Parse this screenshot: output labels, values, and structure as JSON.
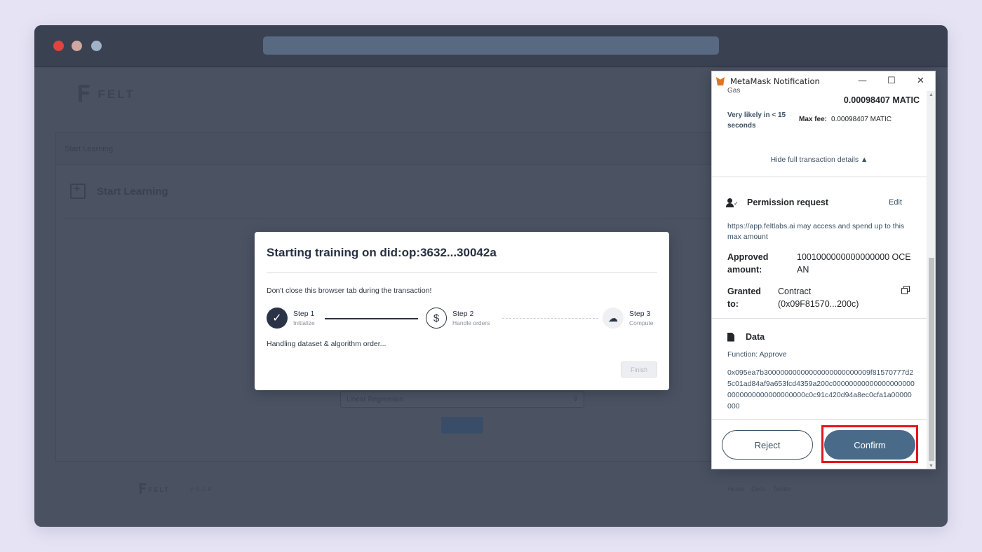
{
  "colors": {
    "accent": "#4a6a8a",
    "highlight": "#e8141b",
    "dark_text": "#24272a",
    "link": "#3b5165"
  },
  "background_app": {
    "logo_text": "FELT",
    "breadcrumb": "Start Learning",
    "page_title": "Start Learning",
    "model_select_value": "Linear Regression",
    "footer_logo_text": "FELT",
    "footer_version": "v 0.1.0",
    "footer_links": [
      "Home",
      "Docs",
      "Twitter"
    ]
  },
  "modal": {
    "title": "Starting training on did:op:3632...30042a",
    "warning": "Don't close this browser tab during the transaction!",
    "steps": [
      {
        "label": "Step 1",
        "sub": "Initialize",
        "icon": "check-icon",
        "state": "done"
      },
      {
        "label": "Step 2",
        "sub": "Handle orders",
        "icon": "dollar-icon",
        "state": "active"
      },
      {
        "label": "Step 3",
        "sub": "Compute",
        "icon": "cloud-icon",
        "state": "pending"
      }
    ],
    "status": "Handling dataset & algorithm order...",
    "finish_label": "Finish"
  },
  "metamask": {
    "window_title": "MetaMask Notification",
    "gas_label": "Gas",
    "gas_value": "0.00098407 MATIC",
    "likely_text": "Very likely in < 15 seconds",
    "max_fee_label": "Max fee:",
    "max_fee_value": "0.00098407 MATIC",
    "hide_details": "Hide full transaction details ▲",
    "permission_title": "Permission request",
    "edit_label": "Edit",
    "permission_desc": "https://app.feltlabs.ai may access and spend up to this max amount",
    "approved_label": "Approved amount:",
    "approved_value": "1001000000000000000 OCEAN",
    "granted_label": "Granted to:",
    "granted_value": "Contract (0x09F81570...200c)",
    "data_title": "Data",
    "function_text": "Function: Approve",
    "hex_data": "0x095ea7b30000000000000000000000009f81570777d25c01ad84af9a653fcd4359a200c000000000000000000000000000000000000000c0c91c420d94a8ec0cfa1a00000000",
    "reject_label": "Reject",
    "confirm_label": "Confirm"
  }
}
